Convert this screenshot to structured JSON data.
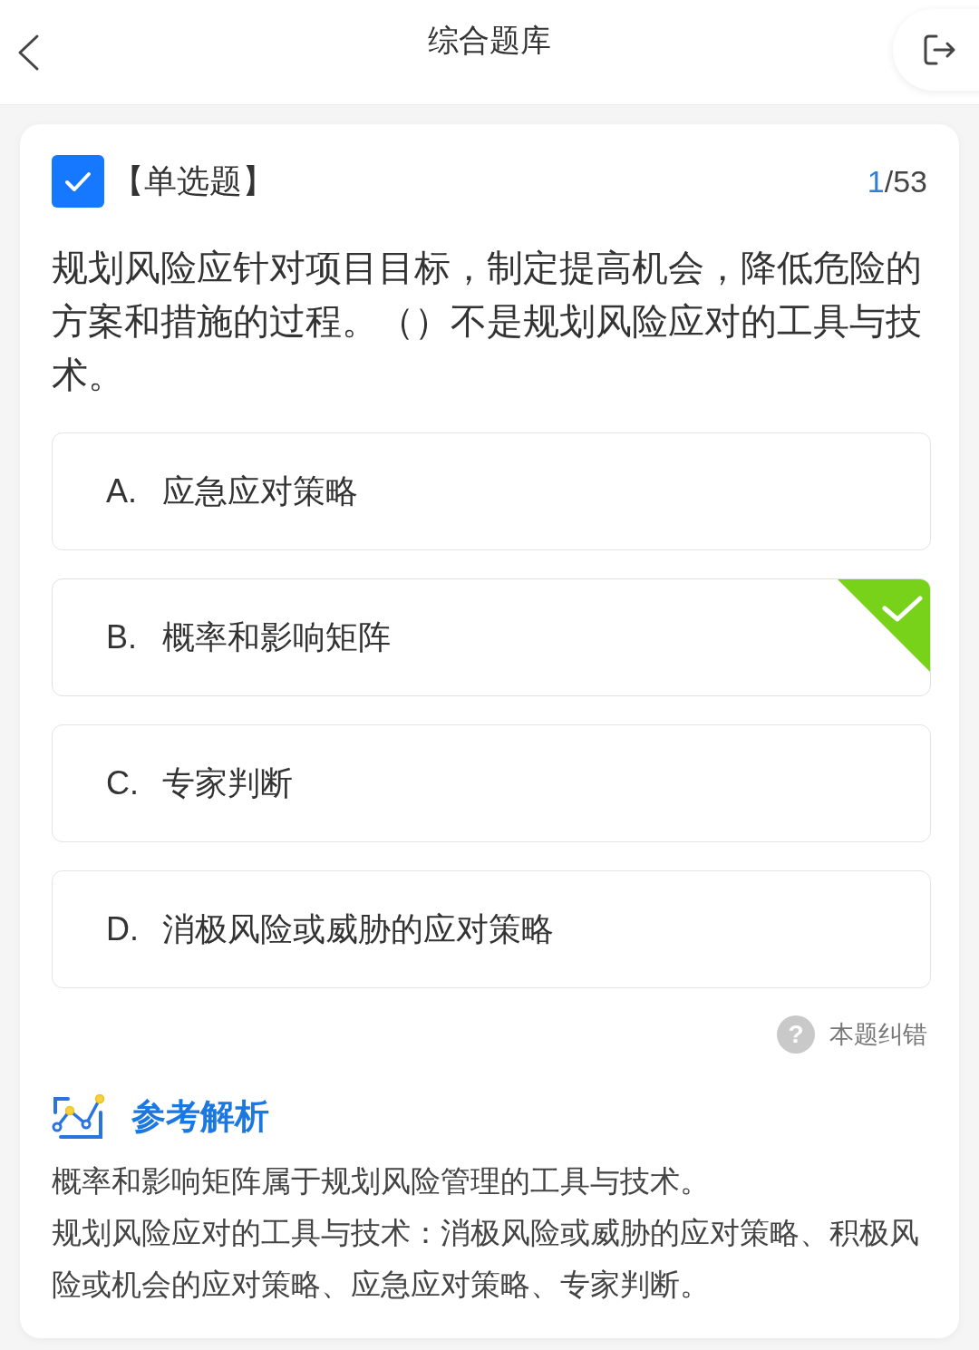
{
  "header": {
    "title": "综合题库"
  },
  "question": {
    "type": "【单选题】",
    "current": "1",
    "total": "/53",
    "text": "规划风险应针对项目目标，制定提高机会，降低危险的方案和措施的过程。（）不是规划风险应对的工具与技术。"
  },
  "options": [
    {
      "letter": "A.",
      "text": "应急应对策略",
      "selected": false
    },
    {
      "letter": "B.",
      "text": "概率和影响矩阵",
      "selected": true
    },
    {
      "letter": "C.",
      "text": "专家判断",
      "selected": false
    },
    {
      "letter": "D.",
      "text": "消极风险或威胁的应对策略",
      "selected": false
    }
  ],
  "report": {
    "icon": "?",
    "label": "本题纠错"
  },
  "analysis": {
    "title": "参考解析",
    "paragraphs": [
      "概率和影响矩阵属于规划风险管理的工具与技术。",
      "规划风险应对的工具与技术：消极风险或威胁的应对策略、积极风险或机会的应对策略、应急应对策略、专家判断。"
    ]
  }
}
